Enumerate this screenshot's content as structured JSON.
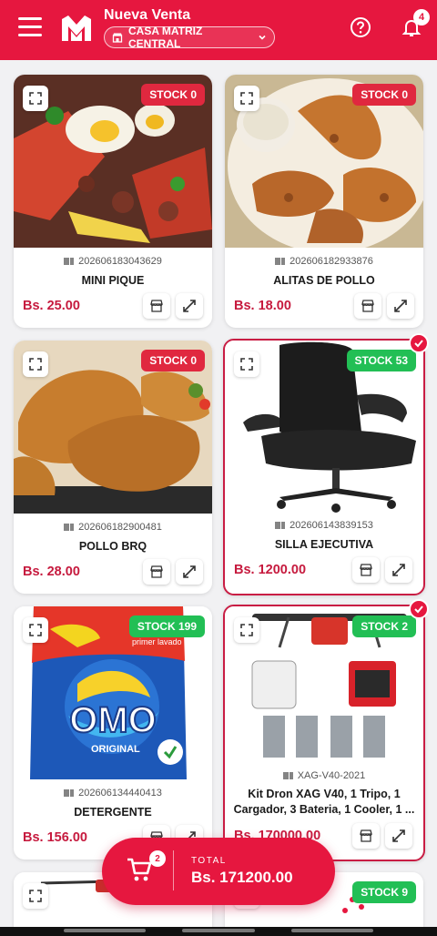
{
  "header": {
    "title": "Nueva Venta",
    "branch": "CASA MATRIZ CENTRAL",
    "notification_count": "4"
  },
  "products": [
    {
      "stock": "STOCK 0",
      "code": "202606183043629",
      "name": "MINI PIQUE",
      "price": "Bs. 25.00",
      "selected": false
    },
    {
      "stock": "STOCK 0",
      "code": "202606182933876",
      "name": "ALITAS DE POLLO",
      "price": "Bs. 18.00",
      "selected": false
    },
    {
      "stock": "STOCK 0",
      "code": "202606182900481",
      "name": "POLLO BRQ",
      "price": "Bs. 28.00",
      "selected": false
    },
    {
      "stock": "STOCK 53",
      "code": "202606143839153",
      "name": "SILLA EJECUTIVA",
      "price": "Bs. 1200.00",
      "selected": true
    },
    {
      "stock": "STOCK 199",
      "code": "202606134440413",
      "name": "DETERGENTE",
      "price": "Bs. 156.00",
      "selected": false
    },
    {
      "stock": "STOCK 2",
      "code": "XAG-V40-2021",
      "name": "Kit Dron XAG V40, 1 Tripo, 1 Cargador, 3 Bateria, 1 Cooler, 1 ...",
      "price": "Bs. 170000.00",
      "selected": true
    },
    {
      "stock": "",
      "code": "",
      "name": "",
      "price": "",
      "selected": false
    },
    {
      "stock": "STOCK 9",
      "code": "",
      "name": "",
      "price": "",
      "selected": false
    }
  ],
  "product_images": {
    "omo_brand": "OMO",
    "omo_sub": "ORIGINAL",
    "omo_tag": "primer lavado"
  },
  "cart": {
    "count": "2",
    "total_label": "TOTAL",
    "total_value": "Bs. 171200.00"
  },
  "colors": {
    "brand": "#e6173f",
    "price": "#c61a3e",
    "stock_out": "#e0283f",
    "stock_in": "#22bf55"
  }
}
